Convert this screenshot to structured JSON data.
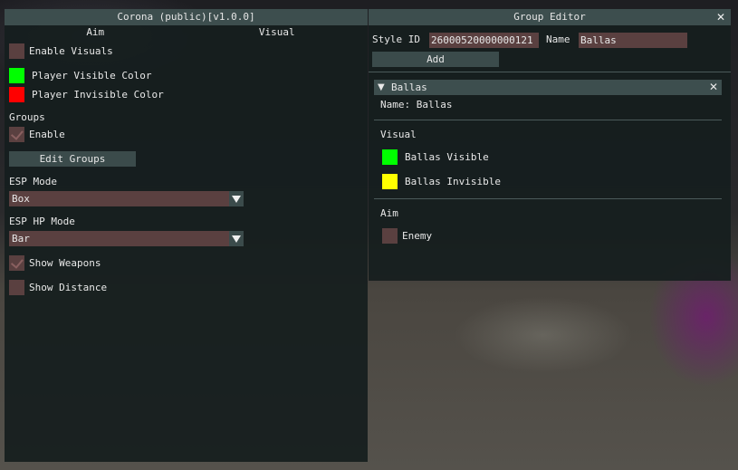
{
  "main_window": {
    "title": "Corona (public)[v1.0.0]",
    "tabs": [
      "Aim",
      "Visual"
    ],
    "enable_visuals": {
      "label": "Enable Visuals",
      "checked": false
    },
    "player_visible_color": {
      "label": "Player Visible Color",
      "color": "#00ff00"
    },
    "player_invisible_color": {
      "label": "Player Invisible Color",
      "color": "#ff0000"
    },
    "groups_label": "Groups",
    "groups_enable": {
      "label": "Enable",
      "checked": true
    },
    "edit_groups_button": "Edit Groups",
    "esp_mode": {
      "label": "ESP Mode",
      "value": "Box"
    },
    "esp_hp_mode": {
      "label": "ESP HP Mode",
      "value": "Bar"
    },
    "show_weapons": {
      "label": "Show Weapons",
      "checked": true
    },
    "show_distance": {
      "label": "Show Distance",
      "checked": false
    }
  },
  "group_editor": {
    "title": "Group Editor",
    "close_glyph": "✕",
    "style_id_label": "Style ID",
    "style_id_value": "26000520000000121",
    "name_label": "Name",
    "name_value": "Ballas",
    "add_button": "Add",
    "group": {
      "header": "Ballas",
      "collapse_glyph": "▼",
      "close_glyph": "✕",
      "name_line": "Name: Ballas",
      "visual_label": "Visual",
      "visible": {
        "label": "Ballas Visible",
        "color": "#00ff00"
      },
      "invisible": {
        "label": "Ballas Invisible",
        "color": "#ffff00"
      },
      "aim_label": "Aim",
      "enemy": {
        "label": "Enemy",
        "checked": false
      }
    }
  },
  "colors": {
    "window_bg": "#161e1e",
    "titlebar": "#3d4e4e",
    "frame": "#5a4040",
    "button": "#3b4b4b"
  }
}
